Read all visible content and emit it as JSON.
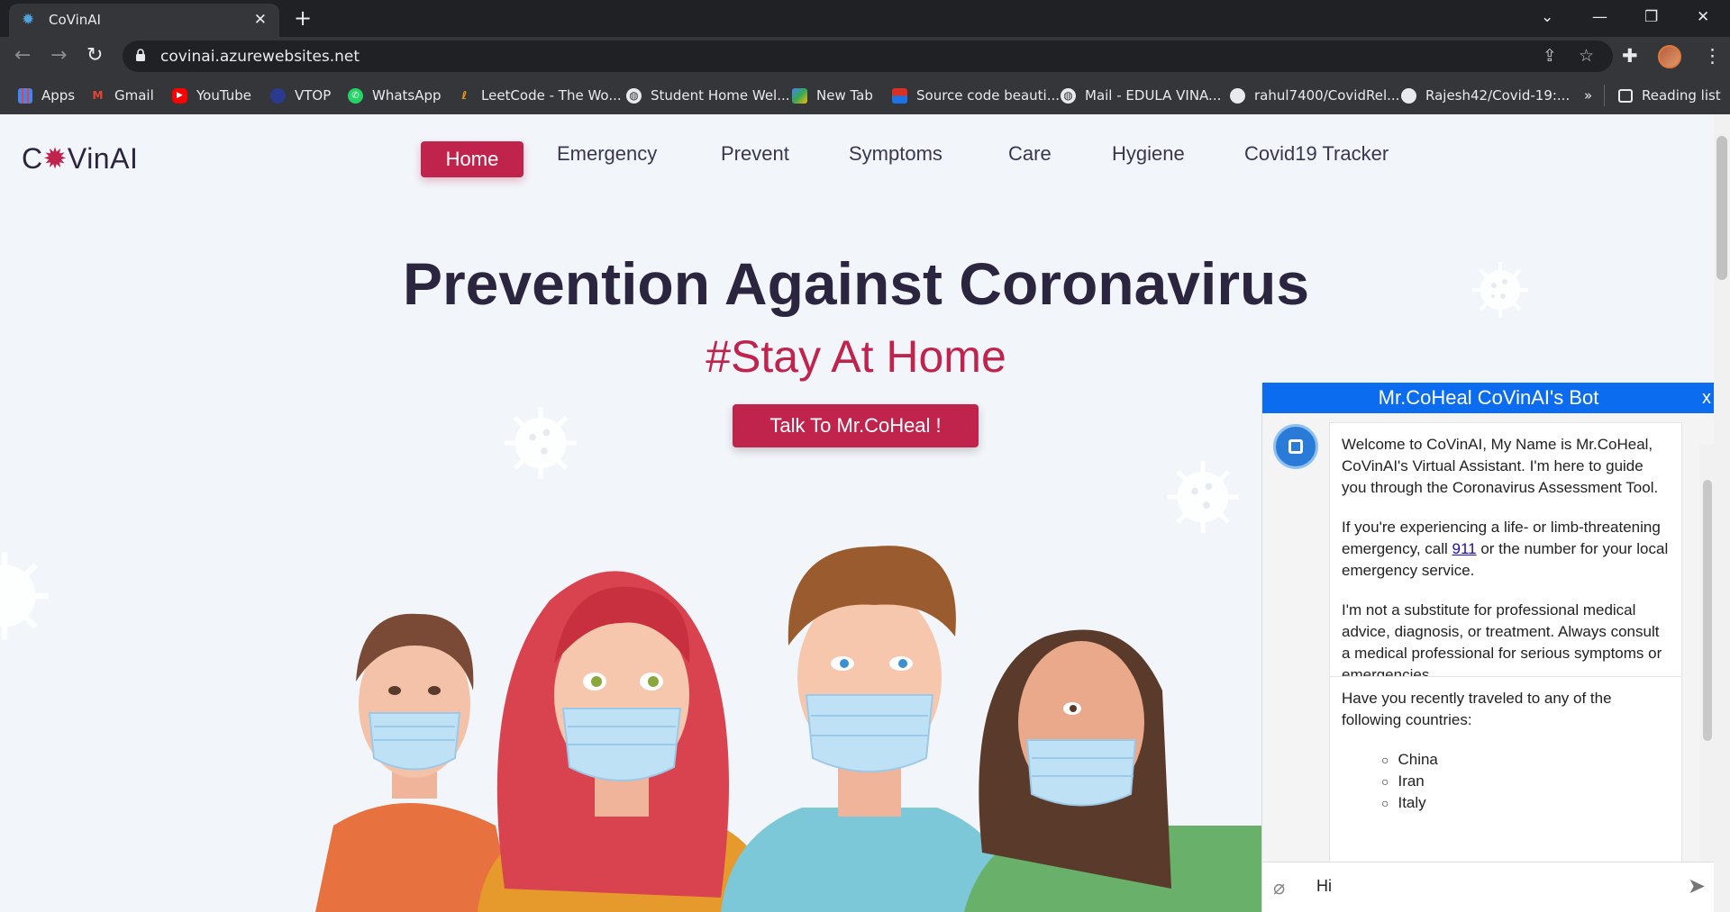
{
  "browser": {
    "tab_title": "CoVinAI",
    "url": "covinai.azurewebsites.net",
    "bookmarks": [
      {
        "label": "Apps",
        "icon": "apps-grid-icon"
      },
      {
        "label": "Gmail",
        "icon": "gmail-icon"
      },
      {
        "label": "YouTube",
        "icon": "youtube-icon"
      },
      {
        "label": "VTOP",
        "icon": "vtop-icon"
      },
      {
        "label": "WhatsApp",
        "icon": "whatsapp-icon"
      },
      {
        "label": "LeetCode - The Wo...",
        "icon": "leetcode-icon"
      },
      {
        "label": "Student Home Wel...",
        "icon": "globe-icon"
      },
      {
        "label": "New Tab",
        "icon": "image-icon"
      },
      {
        "label": "Source code beauti...",
        "icon": "source-icon"
      },
      {
        "label": "Mail - EDULA VINA...",
        "icon": "globe-icon"
      },
      {
        "label": "rahul7400/CovidRel...",
        "icon": "github-icon"
      },
      {
        "label": "Rajesh42/Covid-19:...",
        "icon": "github-icon"
      }
    ],
    "more_bookmarks": "»",
    "reading_list": "Reading list"
  },
  "site": {
    "logo_prefix": "C",
    "logo_virus": "✹",
    "logo_suffix": "VinAI",
    "nav": {
      "home": "Home",
      "emergency": "Emergency",
      "prevent": "Prevent",
      "symptoms": "Symptoms",
      "care": "Care",
      "hygiene": "Hygiene",
      "tracker": "Covid19 Tracker"
    },
    "hero_title": "Prevention Against Coronavirus",
    "hero_subtitle": "#Stay At Home",
    "hero_button": "Talk To Mr.CoHeal !"
  },
  "chat": {
    "title": "Mr.CoHeal CoVinAI's Bot",
    "close": "x",
    "msg1_p1": "Welcome to CoVinAI, My Name is Mr.CoHeal, CoVinAI's Virtual Assistant. I'm here to guide you through the Coronavirus Assessment Tool.",
    "msg1_p2_before": "If you're experiencing a life- or limb-threatening emergency, call ",
    "msg1_p2_link": "911",
    "msg1_p2_after": " or the number for your local emergency service.",
    "msg1_p3": "I'm not a substitute for professional medical advice, diagnosis, or treatment. Always consult a medical professional for serious symptoms or emergencies.",
    "msg2_text": "Have you recently traveled to any of the following countries:",
    "msg2_countries": [
      "China",
      "Iran",
      "Italy"
    ],
    "input_value": "Hi"
  },
  "colors": {
    "brand_red": "#c0244d",
    "chat_header_blue": "#0c6cf0",
    "page_bg": "#f2f6fb"
  }
}
